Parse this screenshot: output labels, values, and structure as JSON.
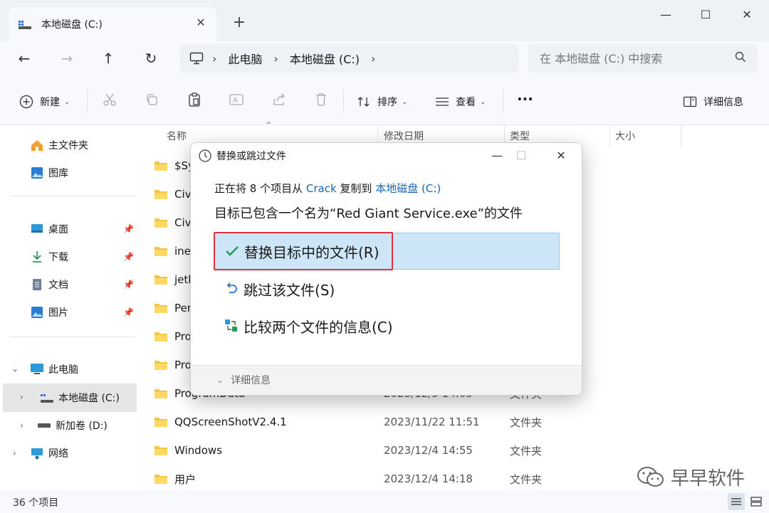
{
  "window": {
    "tab_label": "本地磁盘 (C:)",
    "tab_close": "✕",
    "new_tab": "+",
    "minimize": "—",
    "maximize": "☐",
    "close": "✕"
  },
  "nav": {
    "back": "←",
    "forward": "→",
    "up": "↑",
    "refresh": "↻",
    "breadcrumb": [
      "此电脑",
      "本地磁盘 (C:)"
    ],
    "breadcrumb_sep": "›",
    "search_placeholder": "在 本地磁盘 (C:) 中搜索"
  },
  "toolbar": {
    "new_label": "新建",
    "sort_label": "排序",
    "view_label": "查看",
    "more_label": "···",
    "details_label": "详细信息"
  },
  "sidebar": {
    "home": "主文件夹",
    "gallery": "图库",
    "desktop": "桌面",
    "downloads": "下载",
    "documents": "文档",
    "pictures": "图片",
    "this_pc": "此电脑",
    "local_disk": "本地磁盘 (C:)",
    "new_volume": "新加卷 (D:)",
    "network": "网络"
  },
  "filelist": {
    "headers": {
      "name": "名称",
      "date": "修改日期",
      "type": "类型",
      "size": "大小"
    },
    "rows": [
      {
        "name": "$Sy",
        "date": "",
        "type": ""
      },
      {
        "name": "Civ",
        "date": "",
        "type": ""
      },
      {
        "name": "Civ",
        "date": "",
        "type": ""
      },
      {
        "name": "ine",
        "date": "",
        "type": ""
      },
      {
        "name": "jetb",
        "date": "",
        "type": ""
      },
      {
        "name": "Per",
        "date": "",
        "type": ""
      },
      {
        "name": "Pro",
        "date": "",
        "type": ""
      },
      {
        "name": "Pro",
        "date": "",
        "type": ""
      },
      {
        "name": "ProgramData",
        "date": "2023/12/5 14:05",
        "type": "文件夹"
      },
      {
        "name": "QQScreenShotV2.4.1",
        "date": "2023/11/22 11:51",
        "type": "文件夹"
      },
      {
        "name": "Windows",
        "date": "2023/12/4 14:55",
        "type": "文件夹"
      },
      {
        "name": "用户",
        "date": "2023/12/4 14:18",
        "type": "文件夹"
      }
    ]
  },
  "status": {
    "item_count": "36 个项目"
  },
  "watermark": "早早软件",
  "dialog": {
    "title": "替换或跳过文件",
    "msg_prefix": "正在将 8 个项目从 ",
    "msg_source": "Crack",
    "msg_middle": " 复制到 ",
    "msg_dest": "本地磁盘 (C:)",
    "msg_main": "目标已包含一个名为“Red Giant Service.exe”的文件",
    "opt_replace": "替换目标中的文件(R)",
    "opt_skip": "跳过该文件(S)",
    "opt_compare": "比较两个文件的信息(C)",
    "more_details": "详细信息",
    "colors": {
      "highlight": "#cde6f7",
      "red_box": "#e0303a",
      "link": "#1a64b4"
    }
  }
}
